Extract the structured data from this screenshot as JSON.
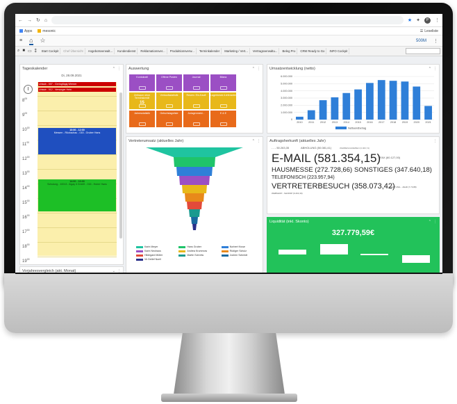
{
  "browser": {
    "bookmarks": [
      "Apps",
      "mesonic"
    ],
    "reading_list": "Leseliste",
    "avatar_letter": "P"
  },
  "app": {
    "zoom": "500M",
    "toolbar_items": [
      "Start Cockpit",
      "Chef Übersicht",
      "Angebotsverwalt...",
      "Kundendienst",
      "Reklamationsver...",
      "Produktionsverw...",
      "Terminkalender",
      "Marketing / Vert...",
      "Vertragsverwaltu...",
      "Beleg Pro",
      "CRM Ready to Go",
      "INFO Cockpit"
    ]
  },
  "calendar": {
    "title": "Tageskalender",
    "date": "Di, 28.09.2021",
    "hours": [
      "8",
      "9",
      "10",
      "11",
      "12",
      "13",
      "14",
      "15",
      "16",
      "17",
      "18",
      "19"
    ],
    "minute": "00",
    "events": [
      {
        "text": "Urlaub - 007 - Geringfügig Werner",
        "color": "red"
      },
      {
        "text": "Urlaub - 012 - Versorger Hein",
        "color": "red"
      },
      {
        "time": "10:00 - 12:00",
        "text": "Messen - Rückschau - 015 - Gruber Hans",
        "color": "blue"
      },
      {
        "time": "14:00 - 16:00",
        "text": "Schulung - 10013 - ibgay it GmbH - 016 - Huber Hans",
        "color": "green"
      }
    ]
  },
  "auswertung": {
    "title": "Auswertung",
    "tiles": [
      {
        "label": "Kontokraft",
        "value": "",
        "color": "#9b4fc4"
      },
      {
        "label": "Offene Posten",
        "value": "",
        "color": "#9b4fc4"
      },
      {
        "label": "Journal",
        "value": "",
        "color": "#9b4fc4"
      },
      {
        "label": "Bilanz",
        "value": "",
        "color": "#9b4fc4"
      },
      {
        "label": "Zeitraum ohne Terminskredit",
        "value": "15",
        "color": "#e8b81a"
      },
      {
        "label": "Verkaufsstatistik",
        "value": "",
        "color": "#e8b81a"
      },
      {
        "label": "Reserv. Ein-Kauft",
        "value": "",
        "color": "#e8b81a"
      },
      {
        "label": "Lagerbestd./Lieferanten",
        "value": "",
        "color": "#e8b81a"
      },
      {
        "label": "Jahresstatistik",
        "value": "",
        "color": "#e86a1a"
      },
      {
        "label": "Geburtstagsliste",
        "value": "",
        "color": "#e86a1a"
      },
      {
        "label": "Anlagenmeld...",
        "value": "",
        "color": "#e86a1a"
      },
      {
        "label": "E & E",
        "value": "",
        "color": "#e86a1a"
      }
    ]
  },
  "umsatz": {
    "title": "Umsatzentwicklung (netto)",
    "legend": "Nettoendbetrag"
  },
  "chart_data": {
    "type": "bar",
    "title": "Umsatzentwicklung (netto)",
    "categories": [
      "2010",
      "2011",
      "2012",
      "2013",
      "2014",
      "2015",
      "2016",
      "2017",
      "2018",
      "2019",
      "2020",
      "2021"
    ],
    "series": [
      {
        "name": "Nettoendbetrag",
        "values": [
          400000,
          1300000,
          2700000,
          3100000,
          3700000,
          4200000,
          5100000,
          5500000,
          5400000,
          5300000,
          4600000,
          1900000
        ]
      }
    ],
    "ylim": [
      0,
      6000000
    ],
    "yticks": [
      "0",
      "1.000.000",
      "2.000.000",
      "3.000.000",
      "4.000.000",
      "5.000.000",
      "6.000.000"
    ],
    "color": "#2f7fd8"
  },
  "vertreter": {
    "title": "Vertreterumsatz (aktuelles Jahr)",
    "legend": [
      {
        "name": "Karin Meyer",
        "color": "#1fc4a0"
      },
      {
        "name": "Hans Gruber",
        "color": "#1fc46a"
      },
      {
        "name": "Norbert Kruse",
        "color": "#2f7fd8"
      },
      {
        "name": "Karin Neuhaus",
        "color": "#9b4fc4"
      },
      {
        "name": "Andrea Krummow",
        "color": "#e8b81a"
      },
      {
        "name": "Rüdiger Schulz",
        "color": "#e8891a"
      },
      {
        "name": "Hildegard Müller",
        "color": "#e34a3a"
      },
      {
        "name": "Martin Schreiw",
        "color": "#1a9a8f"
      },
      {
        "name": "Jochen Schmidt",
        "color": "#1a6aa0"
      },
      {
        "name": "Vk Detlef Noell",
        "color": "#2a2f8a"
      }
    ]
  },
  "herkunft": {
    "title": "Auftragsherkunft (aktuelles Jahr)",
    "words": [
      {
        "text": "- - - 50.263,35",
        "size": 4
      },
      {
        "text": "ABHOLUNG (50.081,41)",
        "size": 4
      },
      {
        "text": "WERBESCHREIBEN (6.906,74)",
        "size": 3
      },
      {
        "text": "E-MAIL (581.354,15)",
        "size": 17
      },
      {
        "text": "FAX (60.127,00)",
        "size": 4
      },
      {
        "text": "HAUSMESSE (272.728,66)",
        "size": 9.5
      },
      {
        "text": "SONSTIGES (347.640,18)",
        "size": 9.5
      },
      {
        "text": "TELEFONISCH (223.957,94)",
        "size": 7
      },
      {
        "text": "VERTRETERBESUCH (358.073,42)",
        "size": 11
      },
      {
        "text": "WARTUNG - JAHR (7.73,88)",
        "size": 3
      },
      {
        "text": "WEBSHOP - SHOPAP (6.263,16)",
        "size": 3
      }
    ]
  },
  "liquiditaet": {
    "title": "Liquidität (inkl. Skonto)",
    "value": "327.779,59€"
  },
  "vorjahr": {
    "title": "Vorjahresvergleich (akt. Monat)"
  },
  "colors": {
    "accent": "#2f7fd8",
    "calendar_bg": "#fbefac",
    "liquid_green": "#22c25a"
  }
}
